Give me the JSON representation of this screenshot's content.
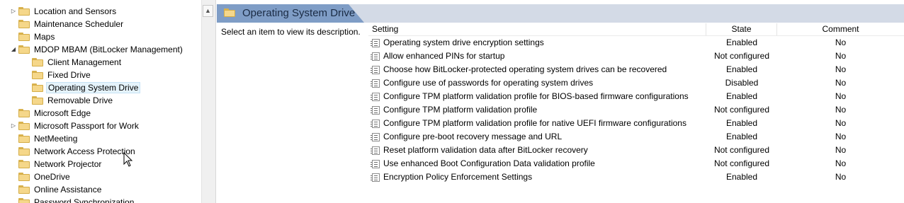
{
  "tree": {
    "items": [
      {
        "label": "Location and Sensors",
        "expander": "collapsed"
      },
      {
        "label": "Maintenance Scheduler",
        "expander": "none"
      },
      {
        "label": "Maps",
        "expander": "none"
      },
      {
        "label": "MDOP MBAM (BitLocker Management)",
        "expander": "expanded"
      },
      {
        "label": "Client Management",
        "expander": "none"
      },
      {
        "label": "Fixed Drive",
        "expander": "none"
      },
      {
        "label": "Operating System Drive",
        "expander": "none",
        "selected": true
      },
      {
        "label": "Removable Drive",
        "expander": "none"
      },
      {
        "label": "Microsoft Edge",
        "expander": "none"
      },
      {
        "label": "Microsoft Passport for Work",
        "expander": "collapsed"
      },
      {
        "label": "NetMeeting",
        "expander": "none"
      },
      {
        "label": "Network Access Protection",
        "expander": "none"
      },
      {
        "label": "Network Projector",
        "expander": "none"
      },
      {
        "label": "OneDrive",
        "expander": "none"
      },
      {
        "label": "Online Assistance",
        "expander": "none"
      },
      {
        "label": "Password Synchronization",
        "expander": "none"
      }
    ]
  },
  "header": {
    "title": "Operating System Drive"
  },
  "description": {
    "text": "Select an item to view its description."
  },
  "table": {
    "columns": {
      "setting": "Setting",
      "state": "State",
      "comment": "Comment"
    },
    "rows": [
      {
        "setting": "Operating system drive encryption settings",
        "state": "Enabled",
        "comment": "No"
      },
      {
        "setting": "Allow enhanced PINs for startup",
        "state": "Not configured",
        "comment": "No"
      },
      {
        "setting": "Choose how BitLocker-protected operating system drives can be recovered",
        "state": "Enabled",
        "comment": "No"
      },
      {
        "setting": "Configure use of passwords for operating system drives",
        "state": "Disabled",
        "comment": "No"
      },
      {
        "setting": "Configure TPM platform validation profile for BIOS-based firmware configurations",
        "state": "Enabled",
        "comment": "No"
      },
      {
        "setting": "Configure TPM platform validation profile",
        "state": "Not configured",
        "comment": "No"
      },
      {
        "setting": "Configure TPM platform validation profile for native UEFI firmware configurations",
        "state": "Enabled",
        "comment": "No"
      },
      {
        "setting": "Configure pre-boot recovery message and URL",
        "state": "Enabled",
        "comment": "No"
      },
      {
        "setting": "Reset platform validation data after BitLocker recovery",
        "state": "Not configured",
        "comment": "No"
      },
      {
        "setting": "Use enhanced Boot Configuration Data validation profile",
        "state": "Not configured",
        "comment": "No"
      },
      {
        "setting": "Encryption Policy Enforcement Settings",
        "state": "Enabled",
        "comment": "No"
      }
    ]
  },
  "icons": {
    "folder": "folder-icon",
    "policy": "policy-setting-icon",
    "collapsed_expander": "chevron-right-icon",
    "expanded_expander": "chevron-down-icon",
    "scroll_up": "scroll-up-arrow-icon",
    "cursor": "mouse-pointer-icon"
  },
  "colors": {
    "header_tab": "#7f9dc6",
    "header_band": "#d3dae6",
    "folder": "#f5d78a",
    "selection": "#e5f3fb"
  }
}
